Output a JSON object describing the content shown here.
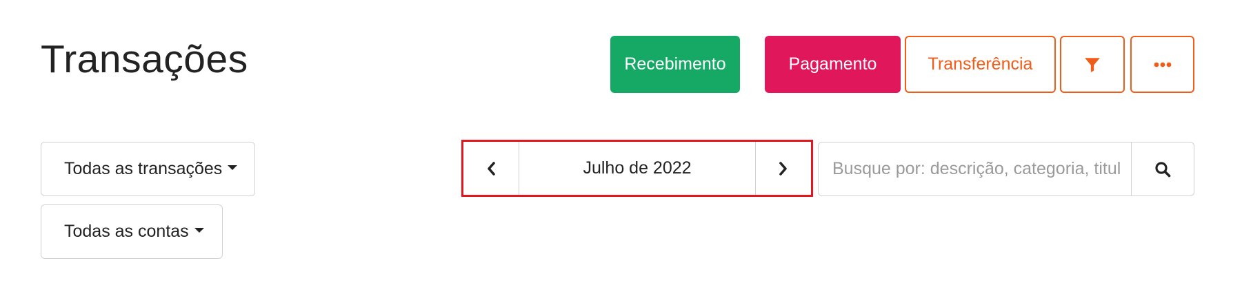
{
  "header": {
    "title": "Transações"
  },
  "actions": {
    "receive_label": "Recebimento",
    "payment_label": "Pagamento",
    "transfer_label": "Transferência",
    "filter_icon": "filter-icon",
    "more_icon": "more-horizontal-icon"
  },
  "filters": {
    "transactions_label": "Todas as transações",
    "accounts_label": "Todas as contas"
  },
  "period": {
    "prev_icon": "chevron-left-icon",
    "label": "Julho de 2022",
    "next_icon": "chevron-right-icon"
  },
  "search": {
    "placeholder": "Busque por: descrição, categoria, titul",
    "value": "",
    "icon": "search-icon"
  },
  "colors": {
    "receive": "#16a865",
    "payment": "#e0175a",
    "accent": "#f25c19",
    "highlight": "#e3161d"
  }
}
